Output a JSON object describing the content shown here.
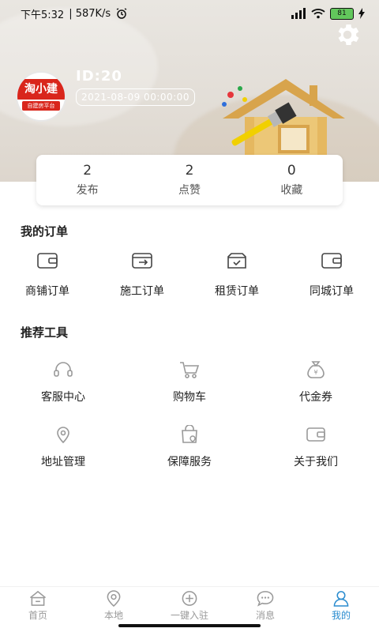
{
  "status_bar": {
    "time": "下午5:32",
    "network_speed": "| 587K/s",
    "battery": "81"
  },
  "header": {
    "logo_text": "淘小建",
    "logo_sub": "自建房平台",
    "user_id": "ID:20",
    "date": "2021-08-09 00:00:00"
  },
  "stats": [
    {
      "value": "2",
      "label": "发布"
    },
    {
      "value": "2",
      "label": "点赞"
    },
    {
      "value": "0",
      "label": "收藏"
    }
  ],
  "orders": {
    "title": "我的订单",
    "items": [
      {
        "label": "商铺订单",
        "icon": "wallet-icon"
      },
      {
        "label": "施工订单",
        "icon": "wallet-arrow-icon"
      },
      {
        "label": "租赁订单",
        "icon": "box-check-icon"
      },
      {
        "label": "同城订单",
        "icon": "wallet-icon"
      }
    ]
  },
  "tools": {
    "title": "推荐工具",
    "items": [
      {
        "label": "客服中心",
        "icon": "headset-icon"
      },
      {
        "label": "购物车",
        "icon": "cart-icon"
      },
      {
        "label": "代金券",
        "icon": "money-bag-icon"
      },
      {
        "label": "地址管理",
        "icon": "location-icon"
      },
      {
        "label": "保障服务",
        "icon": "shield-bag-icon"
      },
      {
        "label": "关于我们",
        "icon": "wallet-icon"
      }
    ]
  },
  "bottom_nav": [
    {
      "label": "首页",
      "icon": "home-icon",
      "active": false
    },
    {
      "label": "本地",
      "icon": "location-icon",
      "active": false
    },
    {
      "label": "一键入驻",
      "icon": "plus-circle-icon",
      "active": false
    },
    {
      "label": "消息",
      "icon": "chat-icon",
      "active": false
    },
    {
      "label": "我的",
      "icon": "user-icon",
      "active": true
    }
  ],
  "colors": {
    "active": "#2a8ccf",
    "brand_red": "#d9261c"
  }
}
